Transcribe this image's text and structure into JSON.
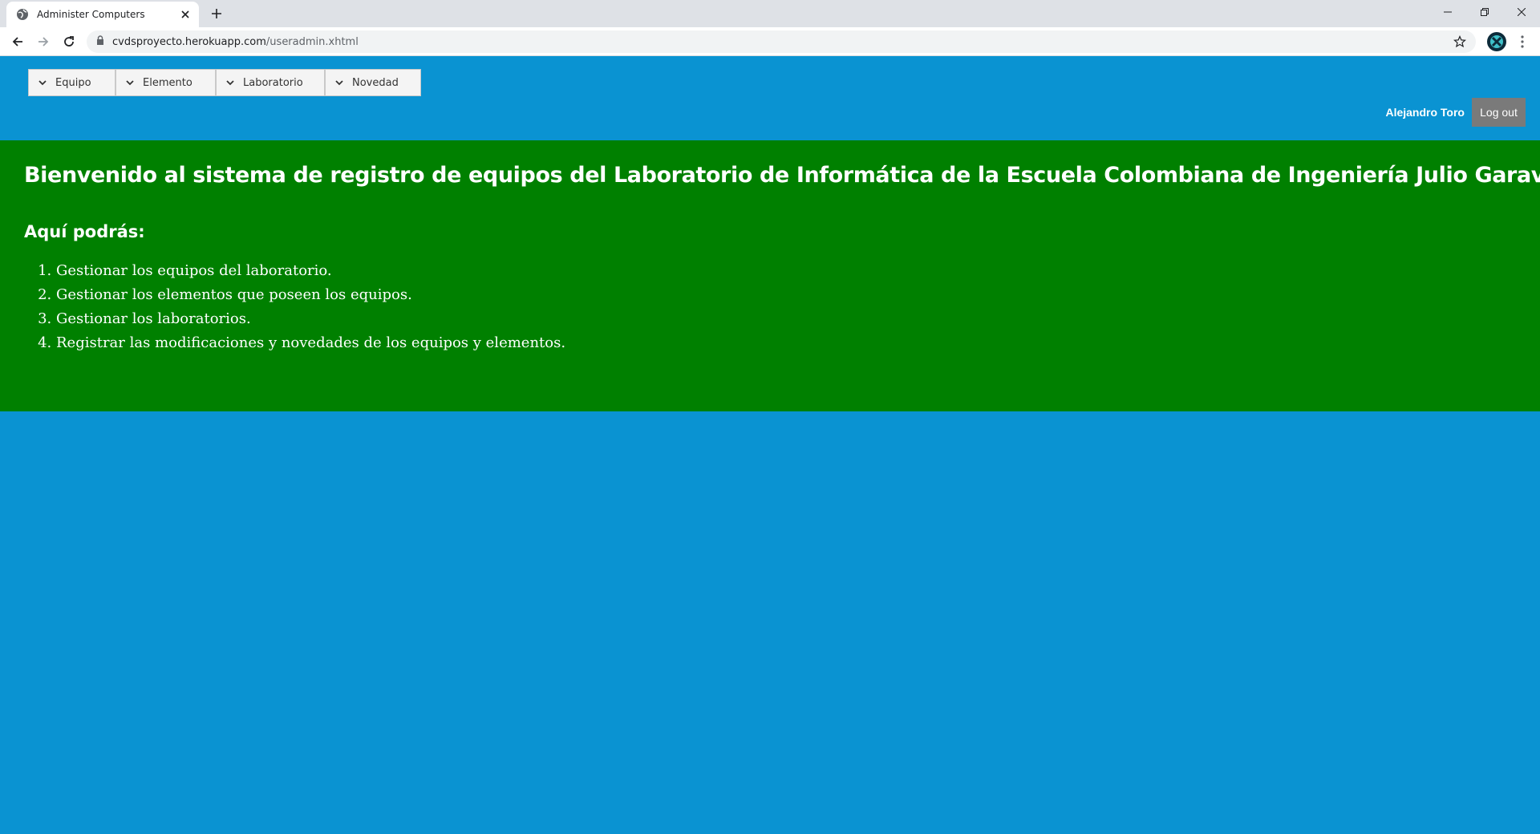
{
  "browser": {
    "tab_title": "Administer Computers",
    "url_host": "cvdsproyecto.herokuapp.com",
    "url_path": "/useradmin.xhtml"
  },
  "menu": {
    "items": [
      {
        "label": "Equipo"
      },
      {
        "label": "Elemento"
      },
      {
        "label": "Laboratorio"
      },
      {
        "label": "Novedad"
      }
    ]
  },
  "user": {
    "name": "Alejandro Toro",
    "logout_label": "Log out"
  },
  "welcome": {
    "title": "Bienvenido al sistema de registro de equipos del Laboratorio de Informática de la Escuela Colombiana de Ingeniería Julio Garavito.",
    "subtitle": "Aquí podrás:",
    "items": [
      "Gestionar los equipos del laboratorio.",
      "Gestionar los elementos que poseen los equipos.",
      "Gestionar los laboratorios.",
      "Registrar las modificaciones y novedades de los equipos y elementos."
    ]
  },
  "colors": {
    "page_background": "#0a93d2",
    "welcome_background": "#008000",
    "logout_button": "#7a7a7a"
  },
  "icons": [
    "globe-icon",
    "close-icon",
    "plus-icon",
    "minimize-icon",
    "restore-icon",
    "back-icon",
    "forward-icon",
    "reload-icon",
    "lock-icon",
    "star-icon",
    "profile-icon",
    "kebab-menu-icon",
    "chevron-down-icon"
  ]
}
